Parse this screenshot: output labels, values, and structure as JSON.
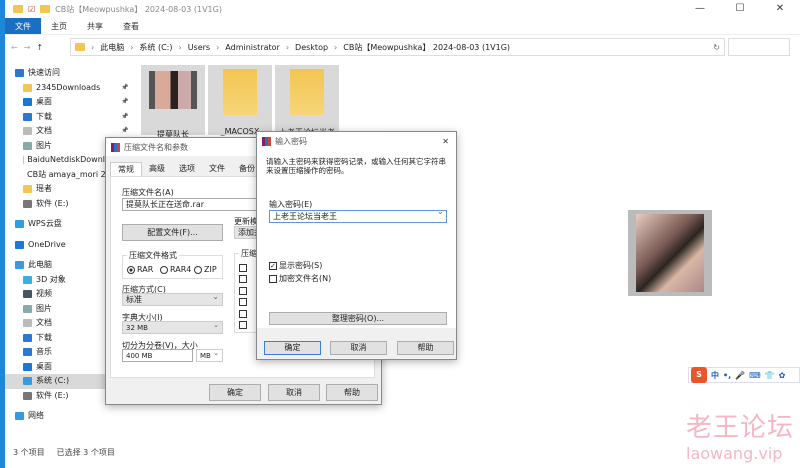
{
  "window": {
    "title": "CB站【Meowpushka】 2024-08-03 (1V1G)",
    "minimize": "—",
    "maximize": "☐",
    "close": "✕"
  },
  "ribbon": [
    "文件",
    "主页",
    "共享",
    "查看"
  ],
  "address": {
    "crumbs": [
      "此电脑",
      "系统 (C:)",
      "Users",
      "Administrator",
      "Desktop",
      "CB站【Meowpushka】 2024-08-03 (1V1G)"
    ]
  },
  "sidebar": [
    {
      "label": "快速访问",
      "indent": 0,
      "color": "#2a78d0"
    },
    {
      "label": "2345Downloads",
      "indent": 1,
      "color": "#f3c552"
    },
    {
      "label": "桌面",
      "indent": 1,
      "color": "#1a78d0"
    },
    {
      "label": "下载",
      "indent": 1,
      "color": "#2a78d0"
    },
    {
      "label": "文档",
      "indent": 1,
      "color": "#bbb"
    },
    {
      "label": "图片",
      "indent": 1,
      "color": "#8aa"
    },
    {
      "label": "BaiduNetdiskDownl",
      "indent": 1,
      "color": "#f3c552"
    },
    {
      "label": "CB站 amaya_mori 2",
      "indent": 1,
      "color": "#f3c552"
    },
    {
      "label": "瑶者",
      "indent": 1,
      "color": "#f3c552"
    },
    {
      "label": "软件 (E:)",
      "indent": 1,
      "color": "#777"
    },
    {
      "label": "WPS云盘",
      "indent": 0,
      "color": "#2aa0e0"
    },
    {
      "label": "OneDrive",
      "indent": 0,
      "color": "#1a78d0"
    },
    {
      "label": "此电脑",
      "indent": 0,
      "color": "#3a9ae0"
    },
    {
      "label": "3D 对象",
      "indent": 1,
      "color": "#3ab0e0"
    },
    {
      "label": "视频",
      "indent": 1,
      "color": "#456"
    },
    {
      "label": "图片",
      "indent": 1,
      "color": "#8aa"
    },
    {
      "label": "文档",
      "indent": 1,
      "color": "#bbb"
    },
    {
      "label": "下载",
      "indent": 1,
      "color": "#2a78d0"
    },
    {
      "label": "音乐",
      "indent": 1,
      "color": "#2a78d0"
    },
    {
      "label": "桌面",
      "indent": 1,
      "color": "#1a78d0"
    },
    {
      "label": "系统 (C:)",
      "indent": 1,
      "color": "#3a9ae0",
      "selected": true
    },
    {
      "label": "软件 (E:)",
      "indent": 1,
      "color": "#777"
    },
    {
      "label": "网络",
      "indent": 0,
      "color": "#3a9ae0"
    }
  ],
  "files": [
    {
      "name": "提莫队长",
      "type": "video"
    },
    {
      "name": "_MACOSX",
      "type": "folder"
    },
    {
      "name": "上老王论坛当老",
      "type": "folder"
    }
  ],
  "status": {
    "count": "3 个项目",
    "selected": "已选择 3 个项目"
  },
  "archive_dialog": {
    "title": "压缩文件名和参数",
    "tabs": [
      "常规",
      "高级",
      "选项",
      "文件",
      "备份"
    ],
    "archive_name_label": "压缩文件名(A)",
    "archive_name": "提莫队长正在送命.rar",
    "profiles_button": "配置文件(F)...",
    "update_mode_label": "更新模式",
    "update_mode": "添加并替换文件",
    "format_label": "压缩文件格式",
    "formats": [
      "RAR",
      "RAR4",
      "ZIP"
    ],
    "format_selected": "RAR",
    "method_label": "压缩方式(C)",
    "method": "标准",
    "dict_label": "字典大小(I)",
    "dict": "32 MB",
    "split_label": "切分为分卷(V)，大小",
    "split": "400 MB",
    "split_unit": "MB",
    "options_label": "压缩选项",
    "ok": "确定",
    "cancel": "取消",
    "help": "帮助"
  },
  "password_dialog": {
    "title": "输入密码",
    "close": "✕",
    "description": "请输入主密码来获得密码记录，或输入任何其它字符串来设置压缩操作的密码。",
    "password_label": "输入密码(E)",
    "password": "上老王论坛当老王",
    "show_password": "显示密码(S)",
    "show_password_checked": true,
    "encrypt_names": "加密文件名(N)",
    "encrypt_names_checked": false,
    "organize": "整理密码(O)...",
    "ok": "确定",
    "cancel": "取消",
    "help": "帮助"
  },
  "ime": {
    "logo": "S",
    "mode": "中",
    "items": [
      "•,",
      "🎤",
      "⌨",
      "👕",
      "✿"
    ]
  },
  "watermark": {
    "title": "老王论坛",
    "url": "laowang.vip"
  }
}
